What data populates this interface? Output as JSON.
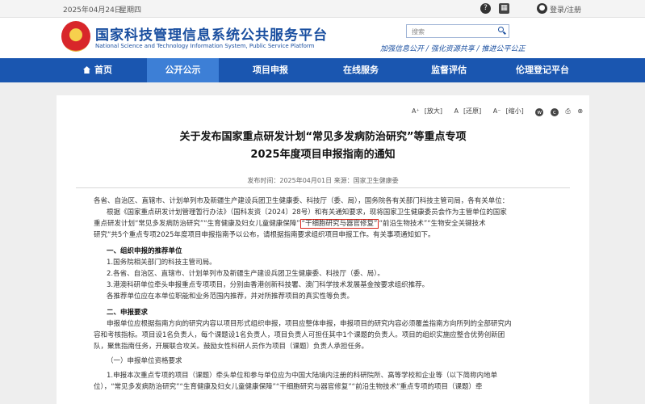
{
  "topbar": {
    "date": "2025年04月24日",
    "weekday": "星期四",
    "login": "登录/注册"
  },
  "header": {
    "title": "国家科技管理信息系统公共服务平台",
    "subtitle": "National Science and Technology Information System, Public Service Platform",
    "search_placeholder": "搜索",
    "slogan": "加强信息公开 / 强化资源共享 / 推进公平公正"
  },
  "nav": [
    "首页",
    "公开公示",
    "项目申报",
    "在线服务",
    "监督评估",
    "伦理登记平台"
  ],
  "toolbar": {
    "zoom_in": "[放大]",
    "zoom_reset": "[还原]",
    "zoom_out": "[缩小]"
  },
  "article": {
    "title_line1": "关于发布国家重点研发计划“常见多发病防治研究”等重点专项",
    "title_line2": "2025年度项目申报指南的通知",
    "meta": "发布时间：2025年04月01日 来源：国家卫生健康委",
    "p1_l1": "各省、自治区、直辖市、计划单列市及新疆生产建设兵团卫生健康委、科技厅（委、局），国务院各有关部门科技主管司局，各有关单位：",
    "p1_l2": "根据《国家重点研发计划管理暂行办法》（国科发资〔2024〕28号）和有关通知要求，现将国家卫生健康委员会作为主管单位的国家",
    "p1_l3_a": "重点研发计划“常见多发病防治研究”“生育健康及妇女儿童健康保障”",
    "p1_l3_hl": "“干细胞研究与器官修复”",
    "p1_l3_b": "“前沿生物技术”“生物安全关键技术",
    "p1_l4": "研究”共5个重点专项2025年度项目申报指南予以公布，请根据指南要求组织项目申报工作。有关事项通知如下。",
    "s1": "一、组织申报的推荐单位",
    "s1_1": "1.国务院相关部门的科技主管司局。",
    "s1_2": "2.各省、自治区、直辖市、计划单列市及新疆生产建设兵团卫生健康委、科技厅（委、局）。",
    "s1_3": "3.港澳科研单位牵头申报重点专项项目，分别由香港创新科技署、澳门科学技术发展基金按要求组织推荐。",
    "s1_4": "各推荐单位应在本单位职能和业务范围内推荐，并对所推荐项目的真实性等负责。",
    "s2": "二、申报要求",
    "s2_l1": "申报单位应根据指南方向的研究内容以项目形式组织申报，项目应整体申报，申报项目的研究内容必须覆盖指南方向所列的全部研究内",
    "s2_l2": "容和考核指标。项目设1名负责人，每个课题设1名负责人，项目负责人可担任其中1个课题的负责人。项目的组织实施应整合优势创新团",
    "s2_l3": "队，聚焦指南任务，开展联合攻关。鼓励女性科研人员作为项目（课题）负责人承担任务。",
    "s2_1": "（一）申报单位资格要求",
    "s2_1_l1": "1.申报本次重点专项的项目（课题）牵头单位和参与单位应为中国大陆境内注册的科研院所、高等学校和企业等（以下简称内地单",
    "s2_1_l2": "位），“常见多发病防治研究”“生育健康及妇女儿童健康保障”“干细胞研究与器官修复”“前沿生物技术”重点专项的项目（课题）牵"
  }
}
